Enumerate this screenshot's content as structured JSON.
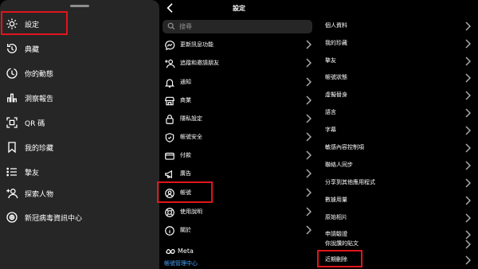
{
  "left_panel": {
    "items": [
      {
        "label": "設定",
        "icon": "gear-icon"
      },
      {
        "label": "典藏",
        "icon": "archive-icon"
      },
      {
        "label": "你的動態",
        "icon": "activity-icon"
      },
      {
        "label": "洞察報告",
        "icon": "insights-icon"
      },
      {
        "label": "QR 碼",
        "icon": "qr-code-icon"
      },
      {
        "label": "我的珍藏",
        "icon": "bookmark-icon"
      },
      {
        "label": "摯友",
        "icon": "close-friends-icon"
      },
      {
        "label": "探索人物",
        "icon": "add-person-icon"
      },
      {
        "label": "新冠病毒資訊中心",
        "icon": "covid-info-icon"
      }
    ]
  },
  "middle_panel": {
    "title": "設定",
    "search_placeholder": "搜尋",
    "items": [
      {
        "label": "更新訊息功能",
        "icon": "messenger-icon"
      },
      {
        "label": "追蹤和邀請朋友",
        "icon": "add-person-icon"
      },
      {
        "label": "通知",
        "icon": "bell-icon"
      },
      {
        "label": "商業",
        "icon": "shop-icon"
      },
      {
        "label": "隱私設定",
        "icon": "lock-icon"
      },
      {
        "label": "帳號安全",
        "icon": "shield-icon"
      },
      {
        "label": "付款",
        "icon": "card-icon"
      },
      {
        "label": "廣告",
        "icon": "megaphone-icon"
      },
      {
        "label": "帳號",
        "icon": "account-icon"
      },
      {
        "label": "使用說明",
        "icon": "lifebuoy-icon"
      },
      {
        "label": "關於",
        "icon": "info-icon"
      }
    ],
    "meta_brand": "Meta",
    "account_center_link": "帳號管理中心"
  },
  "right_panel": {
    "items": [
      {
        "label": "個人資料"
      },
      {
        "label": "我的珍藏"
      },
      {
        "label": "摯友"
      },
      {
        "label": "帳號狀態"
      },
      {
        "label": "虛擬替身"
      },
      {
        "label": "語言"
      },
      {
        "label": "字幕"
      },
      {
        "label": "敏感內容控制項"
      },
      {
        "label": "聯絡人同步"
      },
      {
        "label": "分享到其他應用程式"
      },
      {
        "label": "數據用量"
      },
      {
        "label": "原始相片"
      },
      {
        "label": "申請驗證"
      },
      {
        "label": "你說讚的貼文"
      },
      {
        "label": "近期刪除"
      }
    ]
  },
  "colors": {
    "highlight": "#e0151b",
    "link": "#4aa3ff",
    "left_bg": "#262626",
    "bg": "#000000"
  }
}
